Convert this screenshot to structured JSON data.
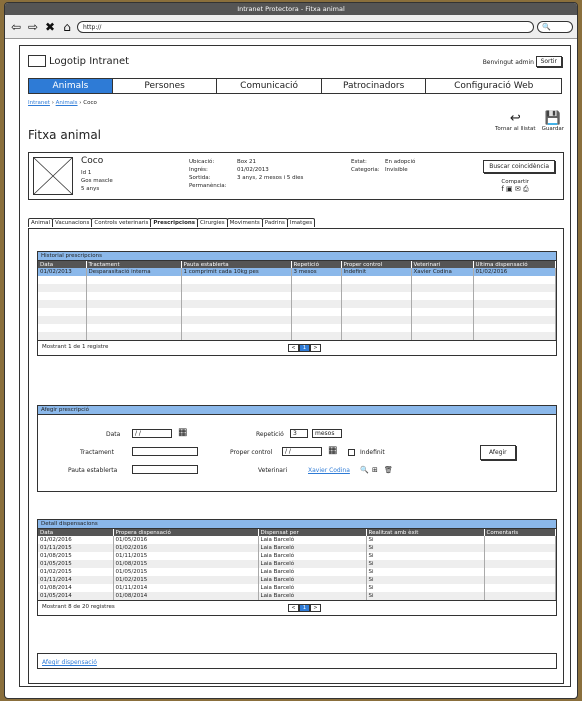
{
  "window": {
    "title": "Intranet Protectora - Fitxa animal",
    "url": "http://"
  },
  "browser": {
    "back": "⇦",
    "forward": "⇨",
    "stop": "✖",
    "home": "⌂",
    "search_icon": "🔍"
  },
  "header": {
    "logo": "Logotip Intranet",
    "welcome": "Benvingut admin",
    "logout": "Sortir"
  },
  "nav": [
    "Animals",
    "Persones",
    "Comunicació",
    "Patrocinadors",
    "Configuració Web"
  ],
  "breadcrumb": {
    "l1": "Intranet",
    "l2": "Animals",
    "current": "Coco",
    "sep": "›"
  },
  "page_title": "Fitxa animal",
  "actions": {
    "back_label": "Tornar al llistat",
    "save_label": "Guardar",
    "back_icon": "↩",
    "save_icon": "💾"
  },
  "animal": {
    "name": "Coco",
    "id": "Id 1",
    "breed": "Gos mascle",
    "age": "5 anys",
    "ubicacio_label": "Ubicació:",
    "ubicacio": "Box 21",
    "ingres_label": "Ingrés:",
    "ingres": "01/02/2013",
    "sortida_label": "Sortida:",
    "sortida": "",
    "permanencia_label": "Permanència:",
    "permanencia": "3 anys, 2 mesos i 5 dies",
    "estat_label": "Estat:",
    "estat": "En adopció",
    "categoria_label": "Categoria:",
    "categoria": "Invisible",
    "buscar": "Buscar coincidència",
    "compartir": "Compartir",
    "share_icons": "f  ▣  ✉  ⎙"
  },
  "tabs": [
    "Animal",
    "Vacunacions",
    "Controls veterinaris",
    "Prescripcions",
    "Cirurgies",
    "Moviments",
    "Padrins",
    "Imatges"
  ],
  "historial": {
    "title": "Historial prescripcions",
    "columns": [
      "Data",
      "Tractament",
      "Pauta establerta",
      "Repetició",
      "Proper control",
      "Veterinari",
      "Ultima dispensació"
    ],
    "rows": [
      [
        "01/02/2013",
        "Desparasitació interna",
        "1 comprimit cada 10kg pes",
        "3 mesos",
        "Indefinit",
        "Xavier Codina",
        "01/02/2016"
      ]
    ],
    "footer": "Mostrant 1 de 1 registre",
    "pager": [
      "<",
      "1",
      ">"
    ]
  },
  "assign": {
    "title": "Afegir prescripció",
    "data_label": "Data",
    "data_value": "/ /",
    "tractament_label": "Tractament",
    "pauta_label": "Pauta establerta",
    "repeticio_label": "Repetició",
    "repeticio_value": "3",
    "repeticio_unit": "mesos",
    "control_label": "Proper control",
    "control_value": "/ /",
    "indefinit_label": "Indefinit",
    "vet_label": "Veterinari",
    "vet_value": "Xavier Codina",
    "button": "Afegir",
    "calendar_icon": "▦",
    "search_icon": "🔍",
    "add_icon": "⊞",
    "delete_icon": "🗑"
  },
  "detall": {
    "title": "Detall dispensacions",
    "columns": [
      "Data",
      "Propera dispensació",
      "Dispensat per",
      "Realitzat amb èxit",
      "Comentaris"
    ],
    "rows": [
      [
        "01/02/2016",
        "01/05/2016",
        "Laia Barceló",
        "Si",
        ""
      ],
      [
        "01/11/2015",
        "01/02/2016",
        "Laia Barceló",
        "Si",
        ""
      ],
      [
        "01/08/2015",
        "01/11/2015",
        "Laia Barceló",
        "Si",
        ""
      ],
      [
        "01/05/2015",
        "01/08/2015",
        "Laia Barceló",
        "Si",
        ""
      ],
      [
        "01/02/2015",
        "01/05/2015",
        "Laia Barceló",
        "Si",
        ""
      ],
      [
        "01/11/2014",
        "01/02/2015",
        "Laia Barceló",
        "Si",
        ""
      ],
      [
        "01/08/2014",
        "01/11/2014",
        "Laia Barceló",
        "Si",
        ""
      ],
      [
        "01/05/2014",
        "01/08/2014",
        "Laia Barceló",
        "Si",
        ""
      ]
    ],
    "footer": "Mostrant 8 de 20 registres",
    "pager": [
      "<",
      "1",
      ">"
    ]
  },
  "afegir_dispensacio": "Afegir dispensació"
}
